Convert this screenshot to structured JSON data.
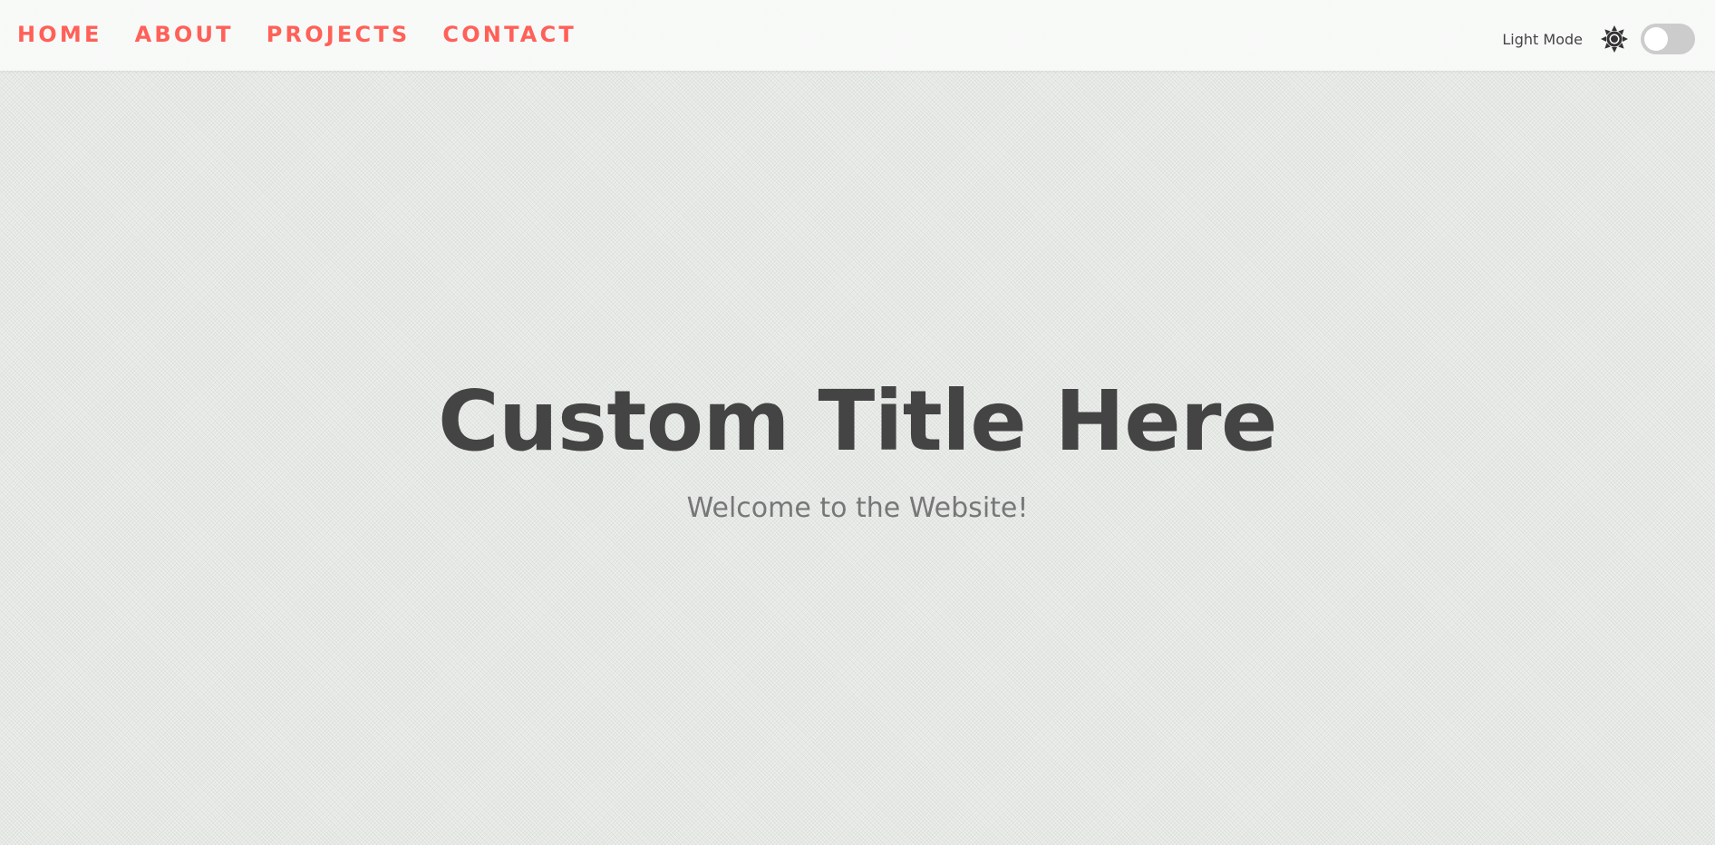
{
  "nav": {
    "items": [
      {
        "label": "HOME"
      },
      {
        "label": "ABOUT"
      },
      {
        "label": "PROJECTS"
      },
      {
        "label": "CONTACT"
      }
    ]
  },
  "mode": {
    "label": "Light Mode",
    "icon": "sun-icon",
    "toggle_on": false
  },
  "hero": {
    "title": "Custom Title Here",
    "subtitle": "Welcome to the Website!"
  },
  "colors": {
    "accent": "#ff6058",
    "text": "#444444",
    "muted": "#777777",
    "toggle_track": "#cccccc"
  }
}
